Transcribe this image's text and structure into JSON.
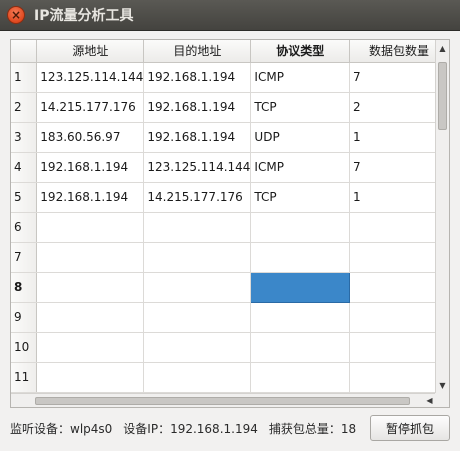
{
  "window": {
    "title": "IP流量分析工具"
  },
  "table": {
    "columns": [
      "源地址",
      "目的地址",
      "协议类型",
      "数据包数量"
    ],
    "rows": [
      {
        "num": "1",
        "cells": [
          "123.125.114.144",
          "192.168.1.194",
          "ICMP",
          "7"
        ]
      },
      {
        "num": "2",
        "cells": [
          "14.215.177.176",
          "192.168.1.194",
          "TCP",
          "2"
        ]
      },
      {
        "num": "3",
        "cells": [
          "183.60.56.97",
          "192.168.1.194",
          "UDP",
          "1"
        ]
      },
      {
        "num": "4",
        "cells": [
          "192.168.1.194",
          "123.125.114.144",
          "ICMP",
          "7"
        ]
      },
      {
        "num": "5",
        "cells": [
          "192.168.1.194",
          "14.215.177.176",
          "TCP",
          "1"
        ]
      },
      {
        "num": "6",
        "cells": [
          "",
          "",
          "",
          ""
        ]
      },
      {
        "num": "7",
        "cells": [
          "",
          "",
          "",
          ""
        ]
      },
      {
        "num": "8",
        "cells": [
          "",
          "",
          "",
          ""
        ]
      },
      {
        "num": "9",
        "cells": [
          "",
          "",
          "",
          ""
        ]
      },
      {
        "num": "10",
        "cells": [
          "",
          "",
          "",
          ""
        ]
      },
      {
        "num": "11",
        "cells": [
          "",
          "",
          "",
          ""
        ]
      }
    ]
  },
  "status": {
    "device": "监听设备：wlp4s0",
    "ip": "设备IP：192.168.1.194",
    "total": "捕获包总量：18"
  },
  "buttons": {
    "pause": "暂停抓包"
  },
  "colors": {
    "selection": "#3b87c9",
    "titlebar": "#4d4c48",
    "close": "#e0481f"
  },
  "icons": {
    "close": "close-icon",
    "up": "arrow-up-icon",
    "down": "arrow-down-icon",
    "left": "arrow-left-icon",
    "right": "arrow-right-icon"
  }
}
